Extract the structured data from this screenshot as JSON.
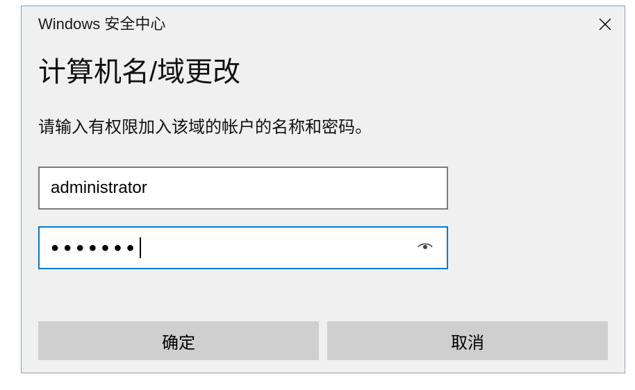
{
  "dialog": {
    "title": "Windows 安全中心",
    "heading": "计算机名/域更改",
    "instruction": "请输入有权限加入该域的帐户的名称和密码。",
    "username_value": "administrator",
    "password_mask": "●●●●●●●",
    "ok_label": "确定",
    "cancel_label": "取消"
  }
}
